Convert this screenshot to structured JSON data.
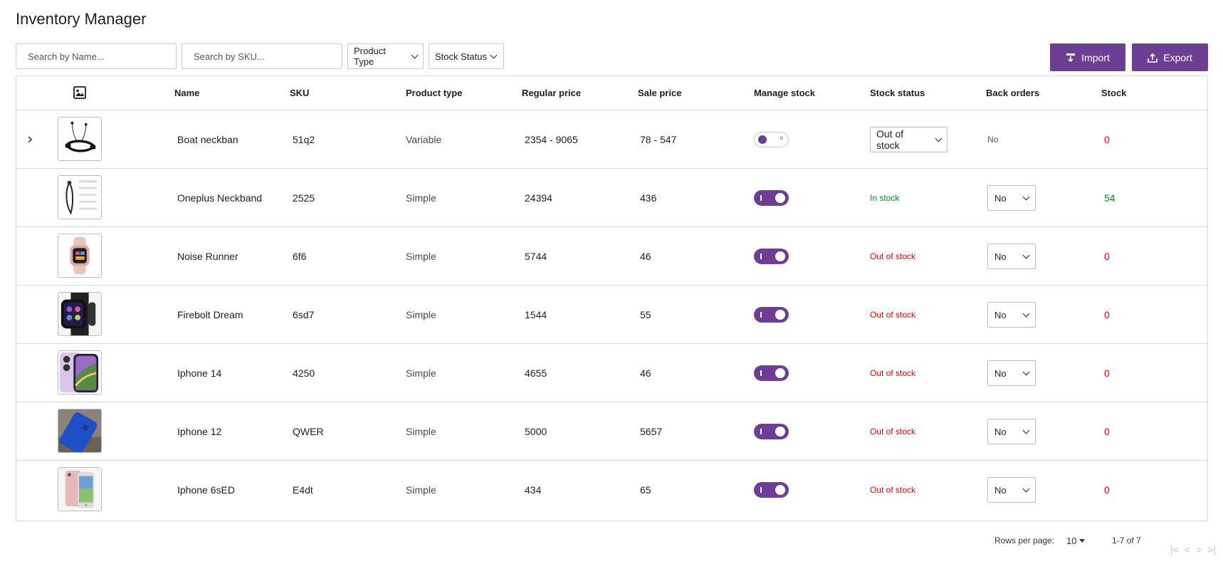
{
  "title": "Inventory Manager",
  "search": {
    "name_placeholder": "Search by Name...",
    "sku_placeholder": "Search by SKU..."
  },
  "filters": {
    "product_type": "Product Type",
    "stock_status": "Stock Status"
  },
  "actions": {
    "import": "Import",
    "export": "Export"
  },
  "columns": {
    "image_icon": "image-icon",
    "name": "Name",
    "sku": "SKU",
    "product_type": "Product type",
    "regular_price": "Regular price",
    "sale_price": "Sale price",
    "manage_stock": "Manage stock",
    "stock_status": "Stock status",
    "back_orders": "Back orders",
    "stock": "Stock"
  },
  "rows": [
    {
      "name": "Boat neckban",
      "sku": "51q2",
      "type": "Variable",
      "regular_price": "2354  - 9065",
      "sale_price": "78   - 547",
      "manage_stock": false,
      "toggle_label": "o",
      "stock_status": "Out of stock",
      "status_kind": "select",
      "back_orders": "No",
      "back_kind": "text",
      "stock": "0",
      "stock_state": "out",
      "expandable": true,
      "expand_icon": "›"
    },
    {
      "name": "Oneplus Neckband",
      "sku": "2525",
      "type": "Simple",
      "regular_price": "24394",
      "sale_price": "436",
      "manage_stock": true,
      "stock_status": "In stock",
      "status_kind": "in",
      "back_orders": "No",
      "back_kind": "select",
      "stock": "54",
      "stock_state": "in"
    },
    {
      "name": "Noise Runner",
      "sku": "6f6",
      "type": "Simple",
      "regular_price": "5744",
      "sale_price": "46",
      "manage_stock": true,
      "stock_status": "Out of stock",
      "status_kind": "out",
      "back_orders": "No",
      "back_kind": "select",
      "stock": "0",
      "stock_state": "out"
    },
    {
      "name": "Firebolt Dream",
      "sku": "6sd7",
      "type": "Simple",
      "regular_price": "1544",
      "sale_price": "55",
      "manage_stock": true,
      "stock_status": "Out of stock",
      "status_kind": "out",
      "back_orders": "No",
      "back_kind": "select",
      "stock": "0",
      "stock_state": "out"
    },
    {
      "name": "Iphone 14",
      "sku": "4250",
      "type": "Simple",
      "regular_price": "4655",
      "sale_price": "46",
      "manage_stock": true,
      "stock_status": "Out of stock",
      "status_kind": "out",
      "back_orders": "No",
      "back_kind": "select",
      "stock": "0",
      "stock_state": "out"
    },
    {
      "name": "Iphone 12",
      "sku": "QWER",
      "type": "Simple",
      "regular_price": "5000",
      "sale_price": "5657",
      "manage_stock": true,
      "stock_status": "Out of stock",
      "status_kind": "out",
      "back_orders": "No",
      "back_kind": "select",
      "stock": "0",
      "stock_state": "out"
    },
    {
      "name": "Iphone 6sED",
      "sku": "E4dt",
      "type": "Simple",
      "regular_price": "434",
      "sale_price": "65",
      "manage_stock": true,
      "stock_status": "Out of stock",
      "status_kind": "out",
      "back_orders": "No",
      "back_kind": "select",
      "stock": "0",
      "stock_state": "out"
    }
  ],
  "pagination": {
    "rows_per_page_label": "Rows per page:",
    "rows_per_page": "10",
    "range": "1-7 of 7",
    "first": "|<",
    "prev": "<",
    "next": ">",
    "last": ">|"
  },
  "colors": {
    "accent": "#6c3f95",
    "in_stock": "#0a8a1f",
    "out_of_stock": "#e00000"
  }
}
